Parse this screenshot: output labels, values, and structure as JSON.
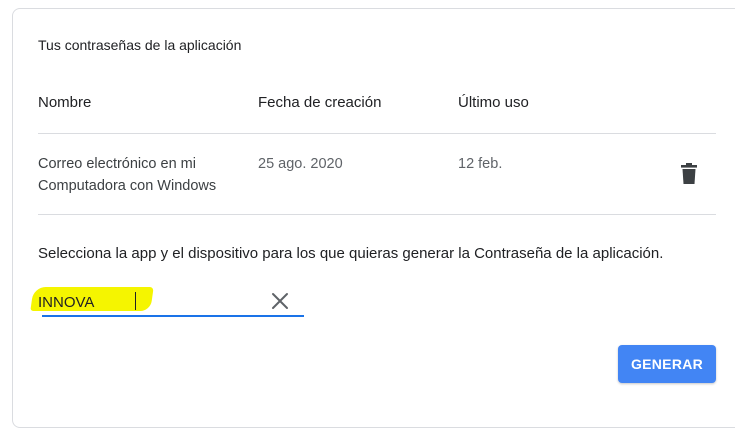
{
  "section": {
    "title": "Tus contraseñas de la aplicación"
  },
  "table": {
    "headers": [
      "Nombre",
      "Fecha de creación",
      "Último uso"
    ],
    "rows": [
      {
        "name_line1": "Correo electrónico en mi",
        "name_line2": "Computadora con Windows",
        "created": "25 ago. 2020",
        "last_used": "12 feb."
      }
    ]
  },
  "generator": {
    "instructions": "Selecciona la app y el dispositivo para los que quieras generar la Contraseña de la aplicación.",
    "input_value": "INNOVA",
    "button_label": "GENERAR"
  },
  "icons": {
    "delete": "trash-icon",
    "clear": "close-icon"
  },
  "colors": {
    "accent": "#4285f4",
    "underline": "#1a73e8",
    "highlight": "#f5f500"
  }
}
